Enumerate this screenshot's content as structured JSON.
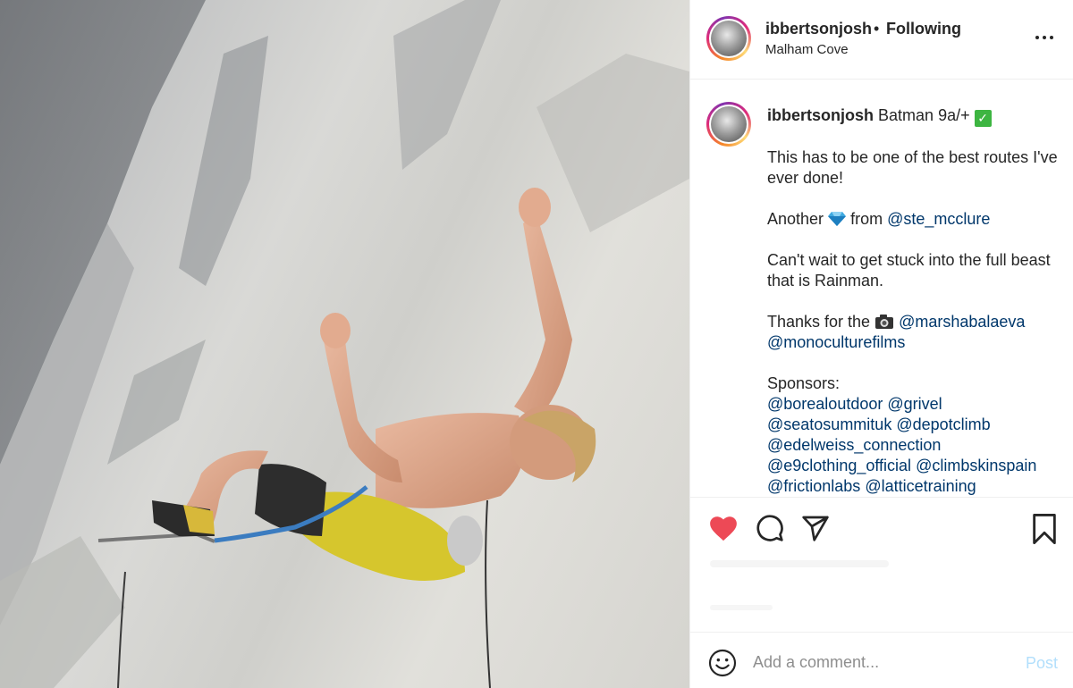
{
  "header": {
    "username": "ibbertsonjosh",
    "separator": "•",
    "follow_status": "Following",
    "location": "Malham Cove"
  },
  "caption": {
    "username": "ibbertsonjosh",
    "route": "Batman 9a/+",
    "line1": "This has to be one of the best routes I've ever done!",
    "another": "Another",
    "from": "from",
    "mention_ste": "@ste_mcclure",
    "wait": "Can't wait to get stuck into the full beast that is Rainman.",
    "thanks": "Thanks for the",
    "mention_marsha": "@marshabalaeva",
    "mention_mono": "@monoculturefilms",
    "sponsors": "Sponsors:",
    "sponsor_mentions": [
      [
        "@borealoutdoor",
        "@grivel"
      ],
      [
        "@seatosummituk",
        "@depotclimb"
      ],
      [
        "@edelweiss_connection"
      ],
      [
        "@e9clothing_official",
        "@climbskinspain"
      ],
      [
        "@frictionlabs",
        "@latticetraining"
      ]
    ]
  },
  "actions": {
    "liked": true,
    "like_color": "#ed4956"
  },
  "comment": {
    "placeholder": "Add a comment...",
    "post_label": "Post"
  },
  "colors": {
    "text": "#262626",
    "mention": "#00376b",
    "post_disabled": "#b2dffc",
    "check": "#3db541"
  }
}
